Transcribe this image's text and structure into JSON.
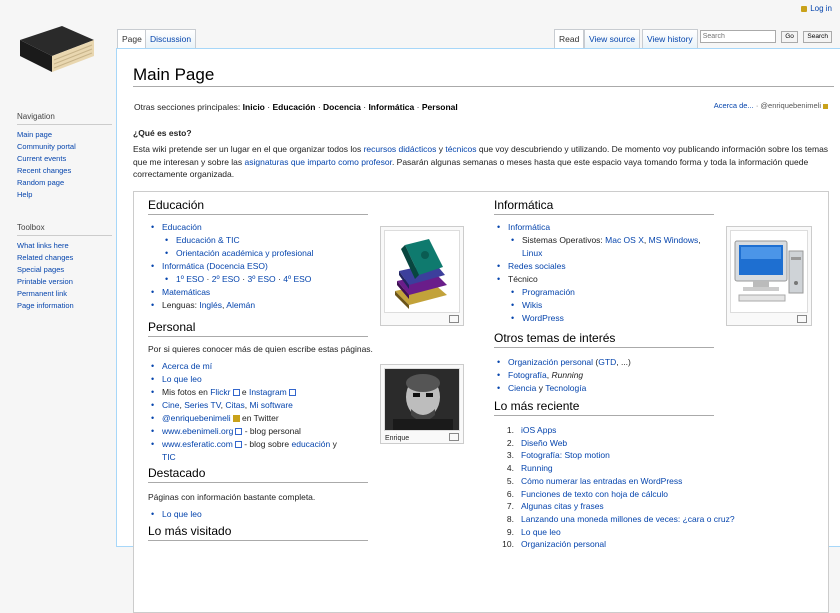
{
  "top": {
    "login": "Log in"
  },
  "tabs": {
    "page": "Page",
    "discussion": "Discussion",
    "read": "Read",
    "view_source": "View source",
    "view_history": "View history"
  },
  "search": {
    "placeholder": "Search",
    "go": "Go",
    "search_btn": "Search"
  },
  "sidebar": {
    "navigation": {
      "heading": "Navigation",
      "items": [
        "Main page",
        "Community portal",
        "Current events",
        "Recent changes",
        "Random page",
        "Help"
      ]
    },
    "toolbox": {
      "heading": "Toolbox",
      "items": [
        "What links here",
        "Related changes",
        "Special pages",
        "Printable version",
        "Permanent link",
        "Page information"
      ]
    }
  },
  "page": {
    "title": "Main Page",
    "otras_label": "Otras secciones principales:",
    "otras_current": "Inicio",
    "otras_links": [
      "Educación",
      "Docencia",
      "Informática",
      "Personal"
    ],
    "sep": "·",
    "acerca": "Acerca de...",
    "acerca_sep": "·",
    "acerca_user": "@enriquebenimeli",
    "question": "¿Qué es esto?",
    "intro": {
      "t1": "Esta wiki pretende ser un lugar en el que organizar todos los ",
      "l1": "recursos didácticos",
      "t2": " y ",
      "l2": "técnicos",
      "t3": " que voy descubriendo y utilizando. De momento voy publicando información sobre los temas que me interesan y sobre las ",
      "l3": "asignaturas que imparto como profesor",
      "t4": ". Pasarán algunas semanas o meses hasta que este espacio vaya tomando forma y toda la información quede correctamente organizada."
    }
  },
  "educacion": {
    "heading": "Educación",
    "items": {
      "educacion": "Educación",
      "edu_tic": "Educación & TIC",
      "orientacion": "Orientación académica y profesional",
      "informatica": "Informática (Docencia ESO)",
      "eso1": "1º ESO",
      "eso2": "2º ESO",
      "eso3": "3º ESO",
      "eso4": "4º ESO",
      "matematicas": "Matemáticas",
      "lenguas_label": "Lenguas: ",
      "ingles": "Inglés",
      "comma": ", ",
      "aleman": "Alemán"
    }
  },
  "personal": {
    "heading": "Personal",
    "intro": "Por si quieres conocer más de quien escribe estas páginas.",
    "items": {
      "acerca": "Acerca de mí",
      "loqueleo": "Lo que leo",
      "fotos_t1": "Mis fotos en ",
      "flickr": "Flickr",
      "fotos_t2": " e ",
      "instagram": "Instagram",
      "cine": "Cine",
      "series": "Series TV",
      "citas": "Citas",
      "software": "Mi software",
      "twitter_user": "@enriquebenimeli",
      "twitter_t": " en Twitter",
      "ebenimeli": "www.ebenimeli.org",
      "blog_personal": " - blog personal",
      "esferatic": "www.esferatic.com",
      "blog_sobre": " - blog sobre ",
      "educacion": "educación",
      "y": " y ",
      "tic": "TIC"
    },
    "photo_caption": "Enrique"
  },
  "destacado": {
    "heading": "Destacado",
    "intro": "Páginas con información bastante completa.",
    "items": [
      "Lo que leo"
    ]
  },
  "visitado": {
    "heading": "Lo más visitado"
  },
  "informatica": {
    "heading": "Informática",
    "items": {
      "informatica": "Informática",
      "so_label": "Sistemas Operativos: ",
      "macos": "Mac OS X",
      "ms": "MS Windows",
      "linux": "Linux",
      "redes": "Redes sociales",
      "tecnico": "Técnico",
      "programacion": "Programación",
      "wikis": "Wikis",
      "wordpress": "WordPress"
    }
  },
  "otros": {
    "heading": "Otros temas de interés",
    "items": {
      "org": "Organización personal",
      "gtd": "GTD",
      "dots": ", ...",
      "foto_l": "Fotografía",
      "running": "Running",
      "ciencia": "Ciencia",
      "tecno": "Tecnología"
    }
  },
  "reciente": {
    "heading": "Lo más reciente",
    "items": [
      {
        "n": "1.",
        "t": "iOS Apps"
      },
      {
        "n": "2.",
        "t": "Diseño Web"
      },
      {
        "n": "3.",
        "t": "Fotografía: Stop motion"
      },
      {
        "n": "4.",
        "t": "Running"
      },
      {
        "n": "5.",
        "t": "Cómo numerar las entradas en WordPress"
      },
      {
        "n": "6.",
        "t": "Funciones de texto con hoja de cálculo"
      },
      {
        "n": "7.",
        "t": "Algunas citas y frases"
      },
      {
        "n": "8.",
        "t": "Lanzando una moneda millones de veces: ¿cara o cruz?"
      },
      {
        "n": "9.",
        "t": "Lo que leo"
      },
      {
        "n": "10.",
        "t": "Organización personal"
      }
    ]
  }
}
